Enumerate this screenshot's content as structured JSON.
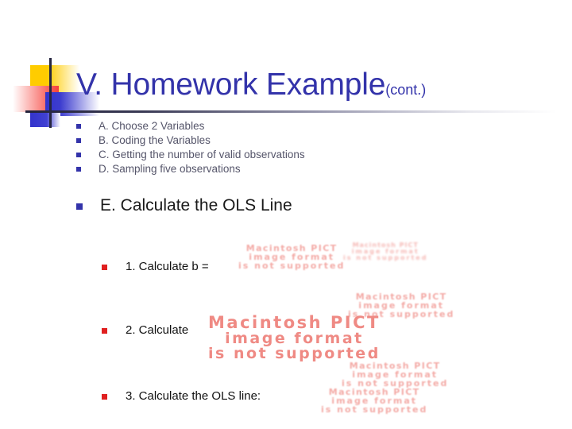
{
  "slide": {
    "title_main": "V. Homework Example",
    "title_suffix": "(cont.)",
    "accent_color": "#3333aa",
    "bullet_color_blue": "#3333aa",
    "bullet_color_red": "#e02020",
    "logo_yellow": "#ffcc00",
    "logo_red": "#f6413c",
    "logo_blue": "#3333cc"
  },
  "upper_list": [
    {
      "label": "A. Choose 2 Variables"
    },
    {
      "label": "B. Coding the Variables"
    },
    {
      "label": "C. Getting the number of valid observations"
    },
    {
      "label": "D. Sampling five observations"
    }
  ],
  "section_e": {
    "label": "E. Calculate the OLS Line"
  },
  "sub_items": [
    {
      "label": "1. Calculate b ="
    },
    {
      "label": "2. Calculate"
    },
    {
      "label": "3. Calculate the OLS line:"
    }
  ],
  "broken_image": {
    "line1": "Macintosh PICT",
    "line2": "image format",
    "line3": "is not supported",
    "color": "#ef8a84"
  }
}
